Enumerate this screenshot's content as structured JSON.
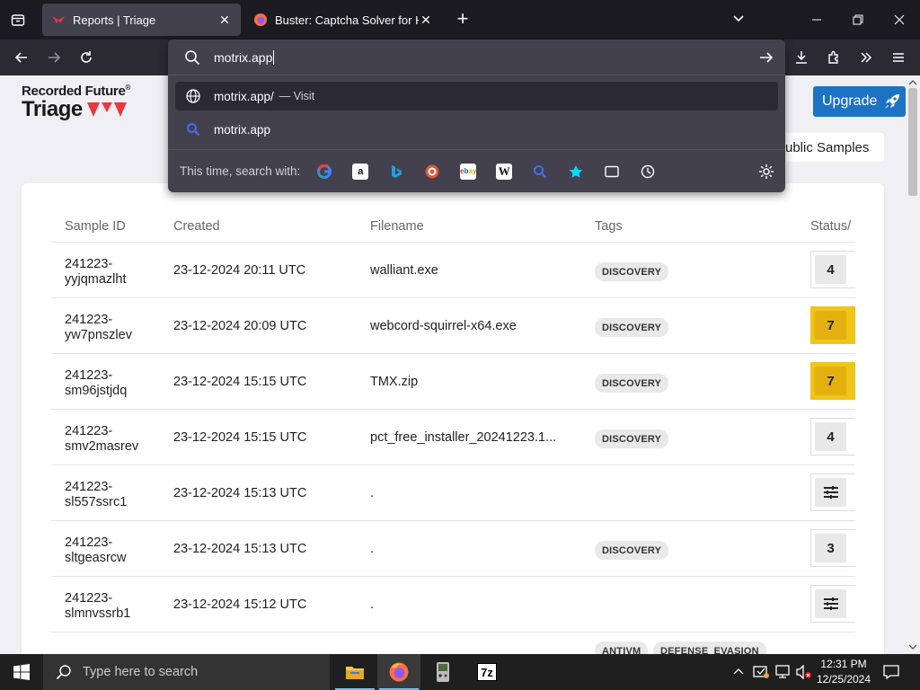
{
  "browser": {
    "tabs": [
      {
        "title": "Reports | Triage",
        "active": true
      },
      {
        "title": "Buster: Captcha Solver for Hum",
        "active": false
      }
    ],
    "url_input": "motrix.app",
    "suggestions": [
      {
        "text": "motrix.app/",
        "suffix": "— Visit",
        "icon": "globe-icon"
      },
      {
        "text": "motrix.app",
        "suffix": "",
        "icon": "search-icon"
      }
    ],
    "search_with_label": "This time, search with:",
    "engines": [
      "google-icon",
      "amazon-icon",
      "bing-icon",
      "duckduckgo-icon",
      "ebay-icon",
      "wikipedia-icon",
      "search-icon",
      "bookmarks-icon",
      "tabs-icon",
      "history-icon"
    ]
  },
  "page": {
    "brand_top": "Recorded Future",
    "brand_reg": "®",
    "brand_name": "Triage",
    "upgrade_label": "Upgrade",
    "public_samples_label": "ublic Samples",
    "table": {
      "headers": [
        "Sample ID",
        "Created",
        "Filename",
        "Tags",
        "Status/"
      ],
      "rows": [
        {
          "id1": "241223-",
          "id2": "yyjqmazlht",
          "created": "23-12-2024 20:11 UTC",
          "filename": "walliant.exe",
          "tags": [
            "DISCOVERY"
          ],
          "score": "4",
          "level": "normal"
        },
        {
          "id1": "241223-",
          "id2": "yw7pnszlev",
          "created": "23-12-2024 20:09 UTC",
          "filename": "webcord-squirrel-x64.exe",
          "tags": [
            "DISCOVERY"
          ],
          "score": "7",
          "level": "high"
        },
        {
          "id1": "241223-",
          "id2": "sm96jstjdq",
          "created": "23-12-2024 15:15 UTC",
          "filename": "TMX.zip",
          "tags": [
            "DISCOVERY"
          ],
          "score": "7",
          "level": "high"
        },
        {
          "id1": "241223-",
          "id2": "smv2masrev",
          "created": "23-12-2024 15:15 UTC",
          "filename": "pct_free_installer_20241223.1...",
          "tags": [
            "DISCOVERY"
          ],
          "score": "4",
          "level": "normal"
        },
        {
          "id1": "241223-",
          "id2": "sl557ssrc1",
          "created": "23-12-2024 15:13 UTC",
          "filename": ".",
          "tags": [],
          "score": "",
          "level": "pending"
        },
        {
          "id1": "241223-",
          "id2": "sltgeasrcw",
          "created": "23-12-2024 15:13 UTC",
          "filename": ".",
          "tags": [
            "DISCOVERY"
          ],
          "score": "3",
          "level": "normal"
        },
        {
          "id1": "241223-",
          "id2": "slmnvssrb1",
          "created": "23-12-2024 15:12 UTC",
          "filename": ".",
          "tags": [],
          "score": "",
          "level": "pending"
        }
      ],
      "partial_row_tags": [
        "ANTIVM",
        "DEFENSE_EVASION"
      ]
    }
  },
  "taskbar": {
    "search_placeholder": "Type here to search",
    "apps": [
      "file-explorer-icon",
      "firefox-icon",
      "gameboy-emulator-icon",
      "7zip-icon"
    ],
    "sevenzip_label": "7z",
    "time": "12:31 PM",
    "date": "12/25/2024"
  },
  "colors": {
    "score_high": "#f0c419",
    "upgrade_blue": "#1d72c4",
    "triage_red": "#e8383d"
  }
}
